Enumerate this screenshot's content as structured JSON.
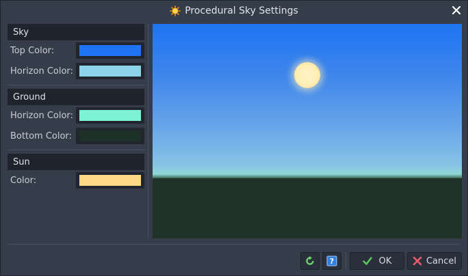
{
  "window": {
    "title": "Procedural Sky Settings",
    "title_icon": "sun-settings-icon",
    "close_icon": "close-icon"
  },
  "sections": {
    "sky": {
      "header": "Sky",
      "top_color": {
        "label": "Top Color:",
        "value": "#1e74f2"
      },
      "horizon_color": {
        "label": "Horizon Color:",
        "value": "#8fd3e8"
      }
    },
    "ground": {
      "header": "Ground",
      "horizon_color": {
        "label": "Horizon Color:",
        "value": "#7df2d6"
      },
      "bottom_color": {
        "label": "Bottom Color:",
        "value": "#1e3128"
      }
    },
    "sun": {
      "header": "Sun",
      "color": {
        "label": "Color:",
        "value": "#ffd985"
      }
    }
  },
  "footer": {
    "reset_icon": "reset-icon",
    "help_icon": "help-icon",
    "ok_label": "OK",
    "cancel_label": "Cancel"
  }
}
